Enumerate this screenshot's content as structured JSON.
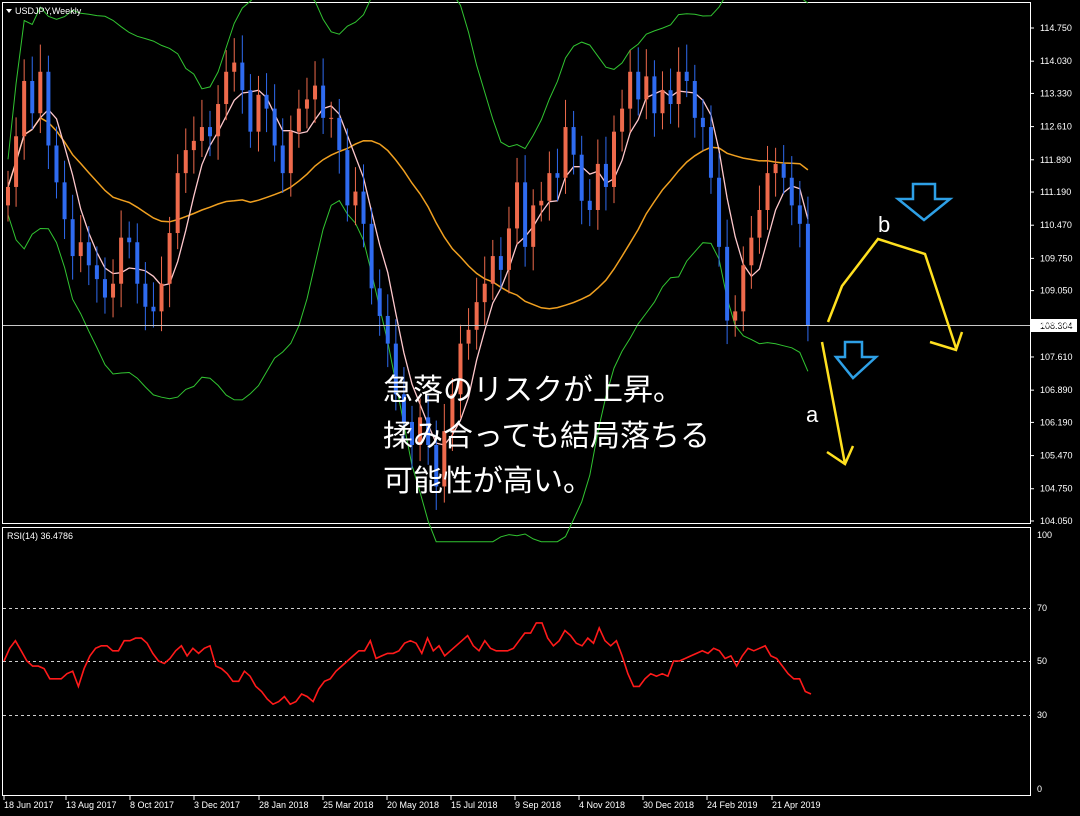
{
  "main_chart": {
    "title": "USDJPY,Weekly",
    "current_price": "108.304",
    "price_ticks": [
      "114.750",
      "114.030",
      "113.330",
      "112.610",
      "111.890",
      "111.190",
      "110.470",
      "109.750",
      "109.050",
      "108.330",
      "107.610",
      "106.890",
      "106.190",
      "105.470",
      "104.750",
      "104.050"
    ]
  },
  "rsi_panel": {
    "title": "RSI(14) 36.4786",
    "levels": [
      "100",
      "70",
      "50",
      "30",
      "0"
    ]
  },
  "dates": [
    "18 Jun 2017",
    "13 Aug 2017",
    "8 Oct 2017",
    "3 Dec 2017",
    "28 Jan 2018",
    "25 Mar 2018",
    "20 May 2018",
    "15 Jul 2018",
    "9 Sep 2018",
    "4 Nov 2018",
    "30 Dec 2018",
    "24 Feb 2019",
    "21 Apr 2019"
  ],
  "annotation": {
    "line1": "急落のリスクが上昇。",
    "line2": "揉み合っても結局落ちる",
    "line3": "可能性が高い。",
    "wave_a": "a",
    "wave_b": "b"
  },
  "colors": {
    "bull": "#ee6a4c",
    "bear": "#2f6bf0",
    "bollinger": "#31c431",
    "ma_short": "#ffc8cc",
    "ma_long": "#f0a020",
    "rsi": "#ff1a1a",
    "arrow": "#2ea0e6",
    "scenario": "#ffe020"
  },
  "chart_data": {
    "type": "candlestick",
    "title": "USDJPY,Weekly",
    "y_range": [
      104.05,
      114.75
    ],
    "close_last": 108.304,
    "series": [
      {
        "name": "RSI(14)",
        "ylim": [
          0,
          100
        ],
        "levels": [
          30,
          50,
          70
        ],
        "last": 36.4786,
        "values": [
          50,
          55,
          58,
          54,
          50,
          48,
          48,
          47,
          43,
          43,
          43,
          45,
          46,
          40,
          47,
          52,
          55,
          56,
          56,
          54,
          54,
          58,
          58,
          59,
          59,
          57,
          53,
          50,
          49,
          51,
          54,
          56,
          52,
          55,
          53,
          55,
          56,
          48,
          47,
          45,
          42,
          42,
          46,
          44,
          40,
          38,
          35,
          33,
          34,
          36,
          33,
          34,
          37,
          36,
          34,
          39,
          42,
          43,
          46,
          48,
          50,
          52,
          54,
          54,
          58,
          51,
          52,
          53,
          53,
          54,
          57,
          58,
          57,
          53,
          59,
          54,
          56,
          52,
          54,
          56,
          58,
          60,
          56,
          54,
          58,
          55,
          54,
          54,
          54,
          55,
          58,
          61,
          61,
          65,
          65,
          59,
          56,
          58,
          62,
          60,
          57,
          56,
          59,
          57,
          63,
          58,
          56,
          58,
          52,
          45,
          40,
          40,
          43,
          45,
          44,
          45,
          44,
          50,
          50,
          51,
          52,
          53,
          54,
          53,
          55,
          54,
          51,
          52,
          48,
          52,
          55,
          54,
          55,
          56,
          52,
          51,
          48,
          45,
          43,
          43,
          38,
          37
        ]
      }
    ]
  }
}
